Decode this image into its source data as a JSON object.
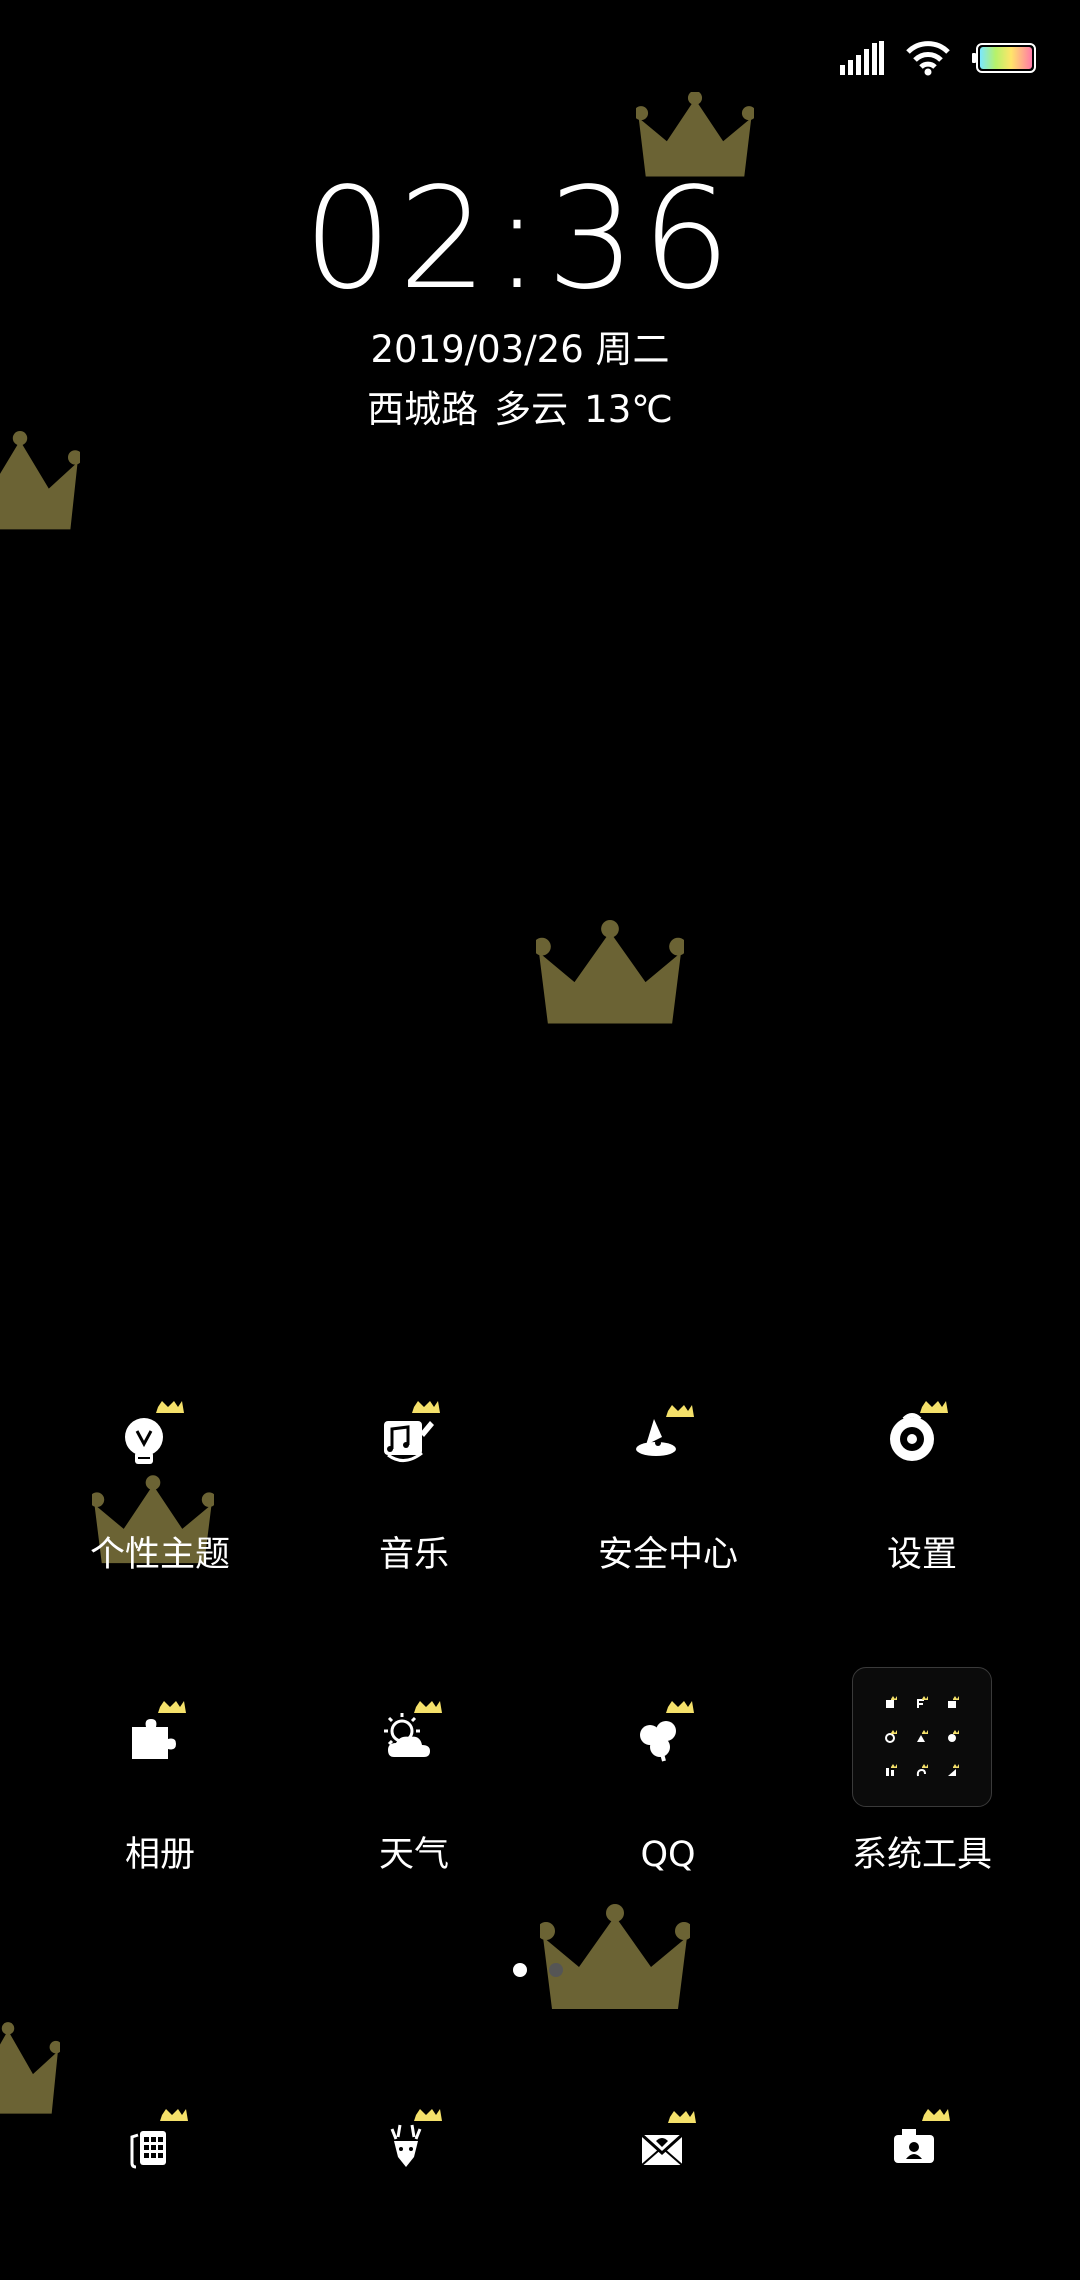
{
  "status_bar": {
    "signal_icon": "signal-icon",
    "wifi_icon": "wifi-icon",
    "battery_icon": "battery-icon"
  },
  "clock_widget": {
    "time": "02:36",
    "date": "2019/03/26 周二",
    "location": "西城路",
    "weather": "多云",
    "temperature": "13℃"
  },
  "apps": [
    {
      "label": "个性主题",
      "icon": "lightbulb-crown-icon"
    },
    {
      "label": "音乐",
      "icon": "music-crown-icon"
    },
    {
      "label": "安全中心",
      "icon": "security-crown-icon"
    },
    {
      "label": "设置",
      "icon": "settings-crown-icon"
    },
    {
      "label": "相册",
      "icon": "puzzle-crown-icon"
    },
    {
      "label": "天气",
      "icon": "weather-crown-icon"
    },
    {
      "label": "QQ",
      "icon": "clover-crown-icon"
    },
    {
      "label": "系统工具",
      "icon": "folder-icon"
    }
  ],
  "page_indicator": {
    "pages": 2,
    "current": 1
  },
  "dock": [
    {
      "icon": "phone-crown-icon"
    },
    {
      "icon": "deer-crown-icon"
    },
    {
      "icon": "mail-crown-icon"
    },
    {
      "icon": "contacts-crown-icon"
    }
  ],
  "colors": {
    "background": "#000000",
    "text": "#ffffff",
    "crown_accent": "#f4e06a",
    "crown_wallpaper": "#6b6334"
  }
}
